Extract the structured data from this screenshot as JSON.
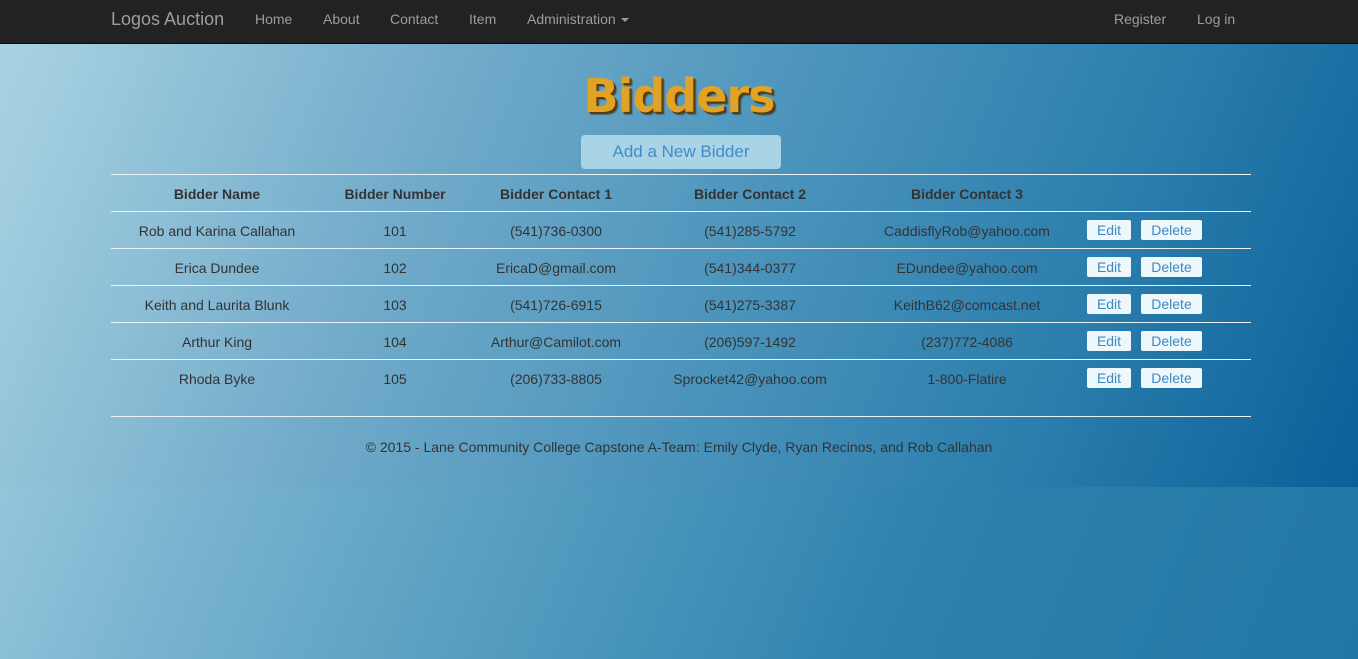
{
  "navbar": {
    "brand": "Logos Auction",
    "links": [
      {
        "label": "Home"
      },
      {
        "label": "About"
      },
      {
        "label": "Contact"
      },
      {
        "label": "Item"
      },
      {
        "label": "Administration",
        "has_dropdown": true
      }
    ],
    "right_links": [
      {
        "label": "Register"
      },
      {
        "label": "Log in"
      }
    ]
  },
  "page": {
    "title": "Bidders",
    "add_button": "Add a New Bidder"
  },
  "table": {
    "headers": [
      "Bidder Name",
      "Bidder Number",
      "Bidder Contact 1",
      "Bidder Contact 2",
      "Bidder Contact 3"
    ],
    "edit_label": "Edit",
    "delete_label": "Delete",
    "rows": [
      [
        "Rob and Karina Callahan",
        "101",
        "(541)736-0300",
        "(541)285-5792",
        "CaddisflyRob@yahoo.com"
      ],
      [
        "Erica Dundee",
        "102",
        "EricaD@gmail.com",
        "(541)344-0377",
        "EDundee@yahoo.com"
      ],
      [
        "Keith and Laurita Blunk",
        "103",
        "(541)726-6915",
        "(541)275-3387",
        "KeithB62@comcast.net"
      ],
      [
        "Arthur King",
        "104",
        "Arthur@Camilot.com",
        "(206)597-1492",
        "(237)772-4086"
      ],
      [
        "Rhoda Byke",
        "105",
        "(206)733-8805",
        "Sprocket42@yahoo.com",
        "1-800-Flatire"
      ]
    ]
  },
  "footer": {
    "text": "© 2015 - Lane Community College Capstone A-Team: Emily Clyde, Ryan Recinos, and Rob Callahan"
  },
  "colors": {
    "navbar_bg": "#222222",
    "nav_text": "#9d9d9d",
    "title": "#e1a326",
    "link_blue": "#428bca",
    "text": "#333333"
  }
}
